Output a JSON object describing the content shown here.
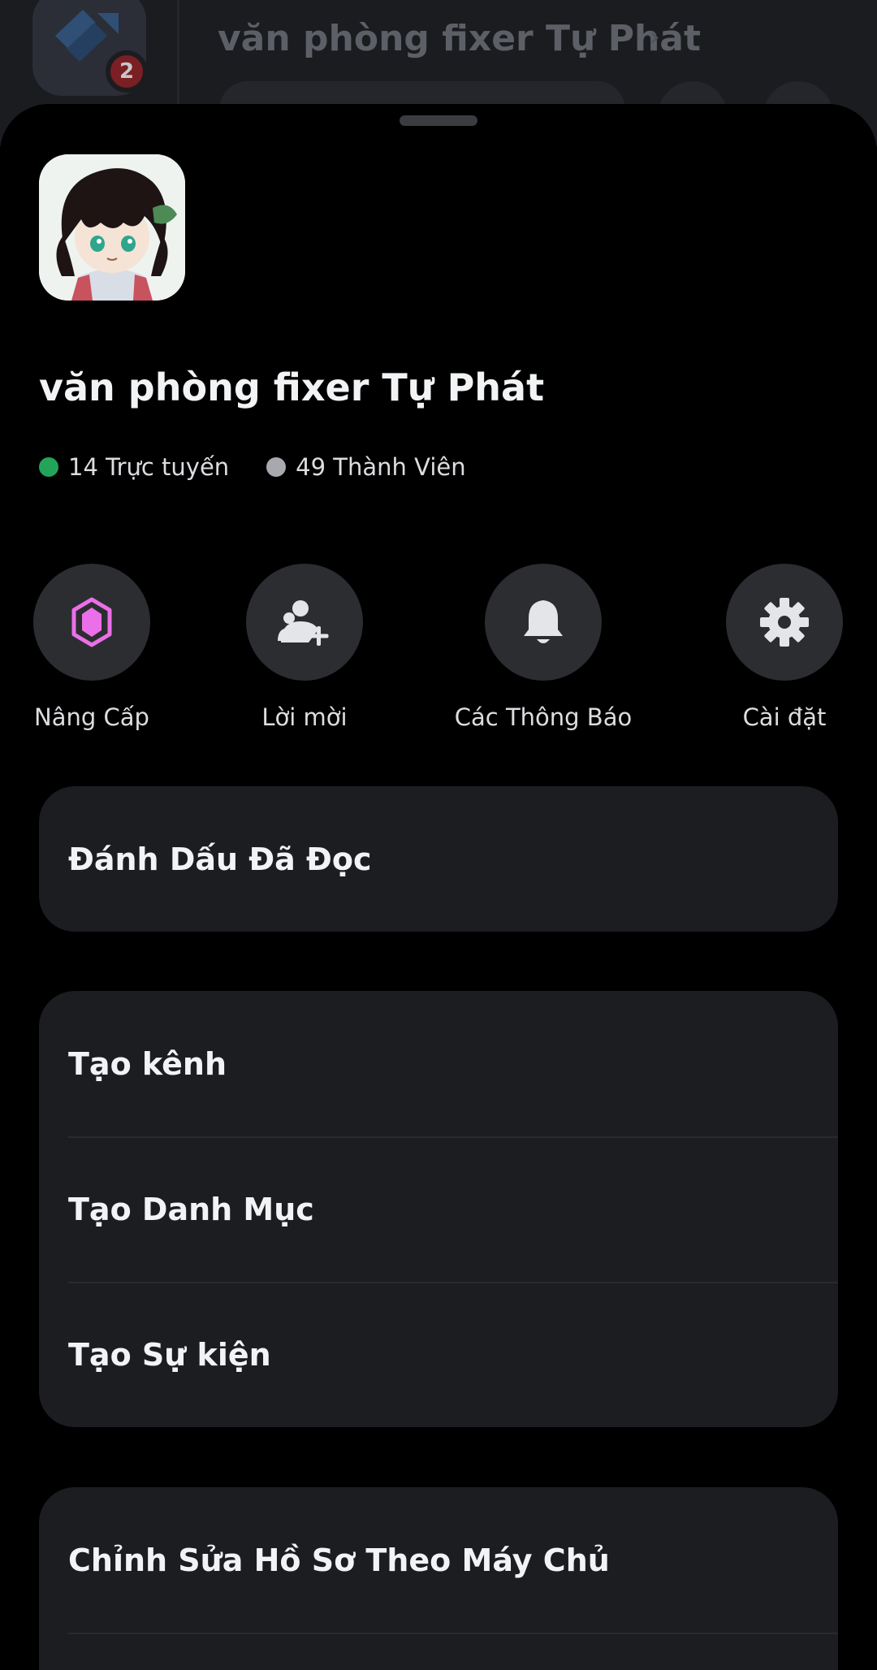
{
  "background": {
    "title": "văn phòng fixer Tự Phát",
    "badge_count": "2"
  },
  "server": {
    "name": "văn phòng fixer Tự Phát",
    "online_count": "14 Trực tuyến",
    "member_count": "49 Thành Viên"
  },
  "actions": [
    {
      "label": "Nâng Cấp",
      "icon": "boost-gem-icon"
    },
    {
      "label": "Lời mời",
      "icon": "invite-people-icon"
    },
    {
      "label": "Các Thông Báo",
      "icon": "bell-icon"
    },
    {
      "label": "Cài đặt",
      "icon": "gear-icon"
    }
  ],
  "menu_groups": [
    {
      "items": [
        "Đánh Dấu Đã Đọc"
      ]
    },
    {
      "items": [
        "Tạo kênh",
        "Tạo Danh Mục",
        "Tạo Sự kiện"
      ]
    },
    {
      "items": [
        "Chỉnh Sửa Hồ Sơ Theo Máy Chủ"
      ]
    }
  ],
  "colors": {
    "online": "#23a559",
    "offline": "#a7a9af",
    "boost": "#eb6fe8",
    "card": "#1c1d21",
    "action_circle": "#2b2d31"
  }
}
